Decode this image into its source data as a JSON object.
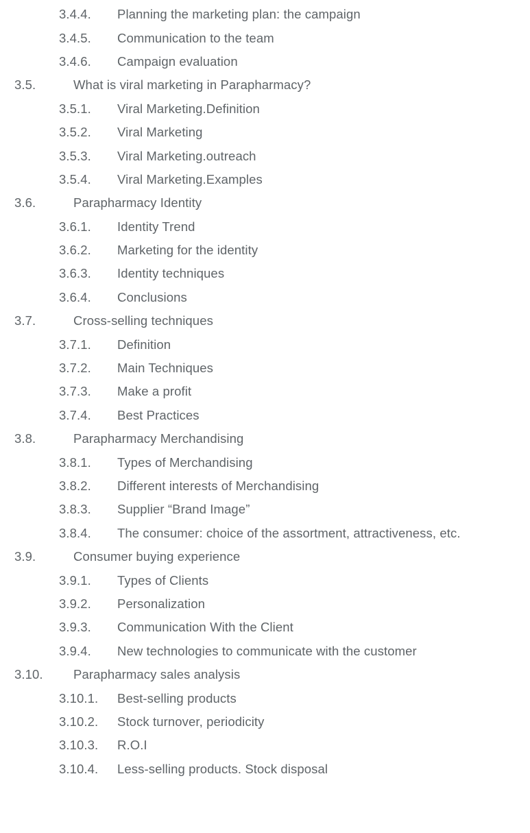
{
  "toc": [
    {
      "num": "3.4.4.",
      "title": "Planning the marketing plan: the campaign",
      "level": 3
    },
    {
      "num": "3.4.5.",
      "title": "Communication to the team",
      "level": 3
    },
    {
      "num": "3.4.6.",
      "title": "Campaign evaluation",
      "level": 3
    },
    {
      "num": "3.5.",
      "title": "What is viral marketing in Parapharmacy?",
      "level": 2
    },
    {
      "num": "3.5.1.",
      "title": "Viral Marketing.Definition",
      "level": 3
    },
    {
      "num": "3.5.2.",
      "title": "Viral Marketing",
      "level": 3
    },
    {
      "num": "3.5.3.",
      "title": "Viral Marketing.outreach",
      "level": 3
    },
    {
      "num": "3.5.4.",
      "title": "Viral Marketing.Examples",
      "level": 3
    },
    {
      "num": "3.6.",
      "title": "Parapharmacy Identity",
      "level": 2
    },
    {
      "num": "3.6.1.",
      "title": "Identity Trend",
      "level": 3
    },
    {
      "num": "3.6.2.",
      "title": "Marketing for the identity",
      "level": 3
    },
    {
      "num": "3.6.3.",
      "title": "Identity techniques",
      "level": 3
    },
    {
      "num": "3.6.4.",
      "title": "Conclusions",
      "level": 3
    },
    {
      "num": "3.7.",
      "title": "Cross-selling techniques",
      "level": 2
    },
    {
      "num": "3.7.1.",
      "title": "Definition",
      "level": 3
    },
    {
      "num": "3.7.2.",
      "title": "Main Techniques",
      "level": 3
    },
    {
      "num": "3.7.3.",
      "title": "Make a profit",
      "level": 3
    },
    {
      "num": "3.7.4.",
      "title": "Best Practices",
      "level": 3
    },
    {
      "num": "3.8.",
      "title": "Parapharmacy Merchandising",
      "level": 2
    },
    {
      "num": "3.8.1.",
      "title": "Types of Merchandising",
      "level": 3
    },
    {
      "num": "3.8.2.",
      "title": "Different interests of Merchandising",
      "level": 3
    },
    {
      "num": "3.8.3.",
      "title": "Supplier “Brand Image”",
      "level": 3
    },
    {
      "num": "3.8.4.",
      "title": "The consumer: choice of the assortment, attractiveness, etc.",
      "level": 3
    },
    {
      "num": "3.9.",
      "title": "Consumer buying experience",
      "level": 2
    },
    {
      "num": "3.9.1.",
      "title": "Types of Clients",
      "level": 3
    },
    {
      "num": "3.9.2.",
      "title": "Personalization",
      "level": 3
    },
    {
      "num": "3.9.3.",
      "title": "Communication With the Client",
      "level": 3
    },
    {
      "num": "3.9.4.",
      "title": "New technologies to communicate with the customer",
      "level": 3
    },
    {
      "num": "3.10.",
      "title": "Parapharmacy sales analysis",
      "level": 2
    },
    {
      "num": "3.10.1.",
      "title": "Best-selling products",
      "level": 3
    },
    {
      "num": "3.10.2.",
      "title": "Stock turnover, periodicity",
      "level": 3
    },
    {
      "num": "3.10.3.",
      "title": "R.O.I",
      "level": 3
    },
    {
      "num": "3.10.4.",
      "title": "Less-selling products. Stock disposal",
      "level": 3
    }
  ],
  "colors": {
    "text": "#5f6468",
    "background": "#ffffff"
  }
}
